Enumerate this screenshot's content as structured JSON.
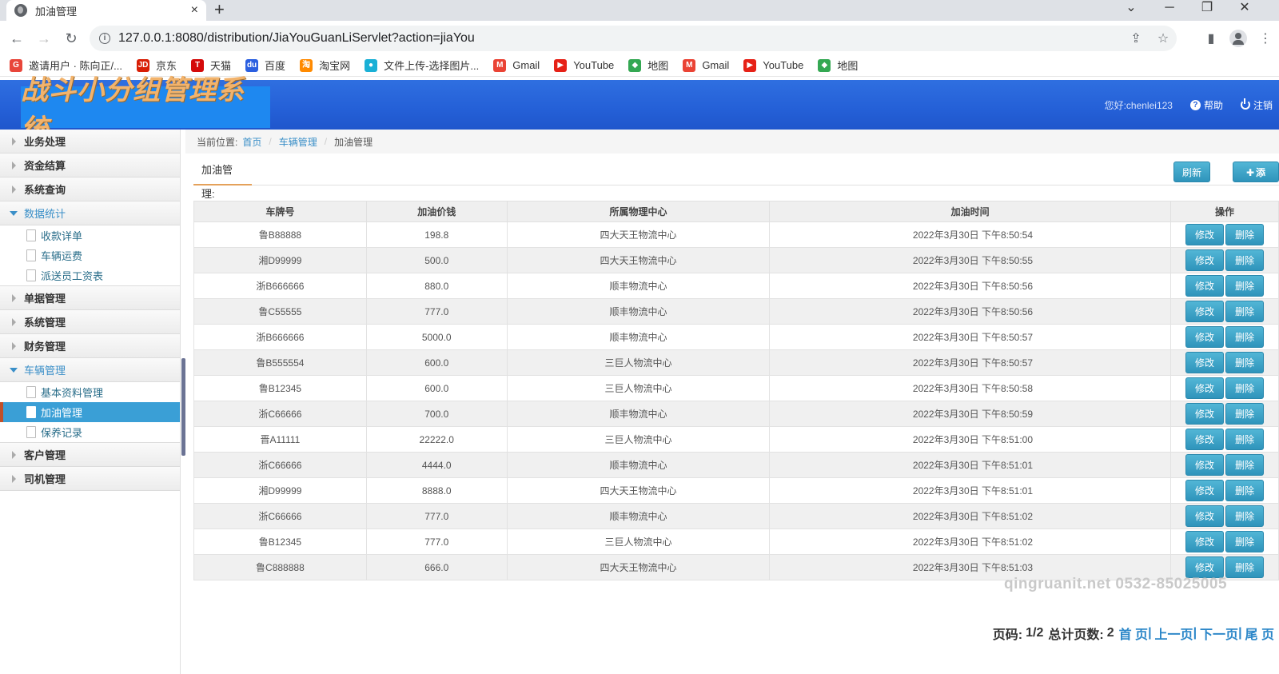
{
  "browser": {
    "tab_title": "加油管理",
    "tab_close": "×",
    "new_tab": "+",
    "url": "127.0.0.1:8080/distribution/JiaYouGuanLiServlet?action=jiaYou",
    "bookmarks": [
      {
        "label": "邀请用户 · 陈向正/...",
        "icon": "G",
        "color": "#e8463a"
      },
      {
        "label": "京东",
        "icon": "JD",
        "color": "#d81e06"
      },
      {
        "label": "天猫",
        "icon": "T",
        "color": "#d40a0a"
      },
      {
        "label": "百度",
        "icon": "du",
        "color": "#2b5fe0"
      },
      {
        "label": "淘宝网",
        "icon": "淘",
        "color": "#ff8a00"
      },
      {
        "label": "文件上传-选择图片...",
        "icon": "●",
        "color": "#1ab0d6"
      },
      {
        "label": "Gmail",
        "icon": "M",
        "color": "#ea4335"
      },
      {
        "label": "YouTube",
        "icon": "▶",
        "color": "#e62117"
      },
      {
        "label": "地图",
        "icon": "◆",
        "color": "#34a853"
      },
      {
        "label": "Gmail",
        "icon": "M",
        "color": "#ea4335"
      },
      {
        "label": "YouTube",
        "icon": "▶",
        "color": "#e62117"
      },
      {
        "label": "地图",
        "icon": "◆",
        "color": "#34a853"
      }
    ]
  },
  "header": {
    "logo_text": "战斗小分组管理系统",
    "greeting": "您好:chenlei123",
    "help": "帮助",
    "logout": "注销"
  },
  "sidebar": {
    "groups": [
      {
        "label": "业务处理",
        "open": false,
        "items": []
      },
      {
        "label": "资金结算",
        "open": false,
        "items": []
      },
      {
        "label": "系统查询",
        "open": false,
        "items": []
      },
      {
        "label": "数据统计",
        "open": true,
        "items": [
          "收款详单",
          "车辆运费",
          "派送员工资表"
        ]
      },
      {
        "label": "单据管理",
        "open": false,
        "items": []
      },
      {
        "label": "系统管理",
        "open": false,
        "items": []
      },
      {
        "label": "财务管理",
        "open": false,
        "items": []
      },
      {
        "label": "车辆管理",
        "open": true,
        "items": [
          "基本资料管理",
          "加油管理",
          "保养记录"
        ],
        "active": "加油管理"
      },
      {
        "label": "客户管理",
        "open": false,
        "items": []
      },
      {
        "label": "司机管理",
        "open": false,
        "items": []
      }
    ]
  },
  "breadcrumb": {
    "prefix": "当前位置:",
    "home": "首页",
    "parent": "车辆管理",
    "current": "加油管理"
  },
  "section": {
    "title": "加油管理:",
    "refresh": "刷新",
    "add": "添加"
  },
  "table": {
    "headers": [
      "车牌号",
      "加油价钱",
      "所属物理中心",
      "加油时间",
      "操作"
    ],
    "edit_label": "修改",
    "delete_label": "删除",
    "rows": [
      [
        "鲁B88888",
        "198.8",
        "四大天王物流中心",
        "2022年3月30日 下午8:50:54"
      ],
      [
        "湘D99999",
        "500.0",
        "四大天王物流中心",
        "2022年3月30日 下午8:50:55"
      ],
      [
        "浙B666666",
        "880.0",
        "顺丰物流中心",
        "2022年3月30日 下午8:50:56"
      ],
      [
        "鲁C55555",
        "777.0",
        "顺丰物流中心",
        "2022年3月30日 下午8:50:56"
      ],
      [
        "浙B666666",
        "5000.0",
        "顺丰物流中心",
        "2022年3月30日 下午8:50:57"
      ],
      [
        "鲁B555554",
        "600.0",
        "三巨人物流中心",
        "2022年3月30日 下午8:50:57"
      ],
      [
        "鲁B12345",
        "600.0",
        "三巨人物流中心",
        "2022年3月30日 下午8:50:58"
      ],
      [
        "浙C66666",
        "700.0",
        "顺丰物流中心",
        "2022年3月30日 下午8:50:59"
      ],
      [
        "晋A11111",
        "22222.0",
        "三巨人物流中心",
        "2022年3月30日 下午8:51:00"
      ],
      [
        "浙C66666",
        "4444.0",
        "顺丰物流中心",
        "2022年3月30日 下午8:51:01"
      ],
      [
        "湘D99999",
        "8888.0",
        "四大天王物流中心",
        "2022年3月30日 下午8:51:01"
      ],
      [
        "浙C66666",
        "777.0",
        "顺丰物流中心",
        "2022年3月30日 下午8:51:02"
      ],
      [
        "鲁B12345",
        "777.0",
        "三巨人物流中心",
        "2022年3月30日 下午8:51:02"
      ],
      [
        "鲁C888888",
        "666.0",
        "四大天王物流中心",
        "2022年3月30日 下午8:51:03"
      ]
    ]
  },
  "watermark": "qingruanit.net 0532-85025005",
  "pager": {
    "page_label": "页码:",
    "page_value": "1/2",
    "total_label": "总计页数:",
    "total_value": "2",
    "first": "首 页",
    "prev": "上一页",
    "next": "下一页",
    "last": "尾 页",
    "sep": "|"
  }
}
